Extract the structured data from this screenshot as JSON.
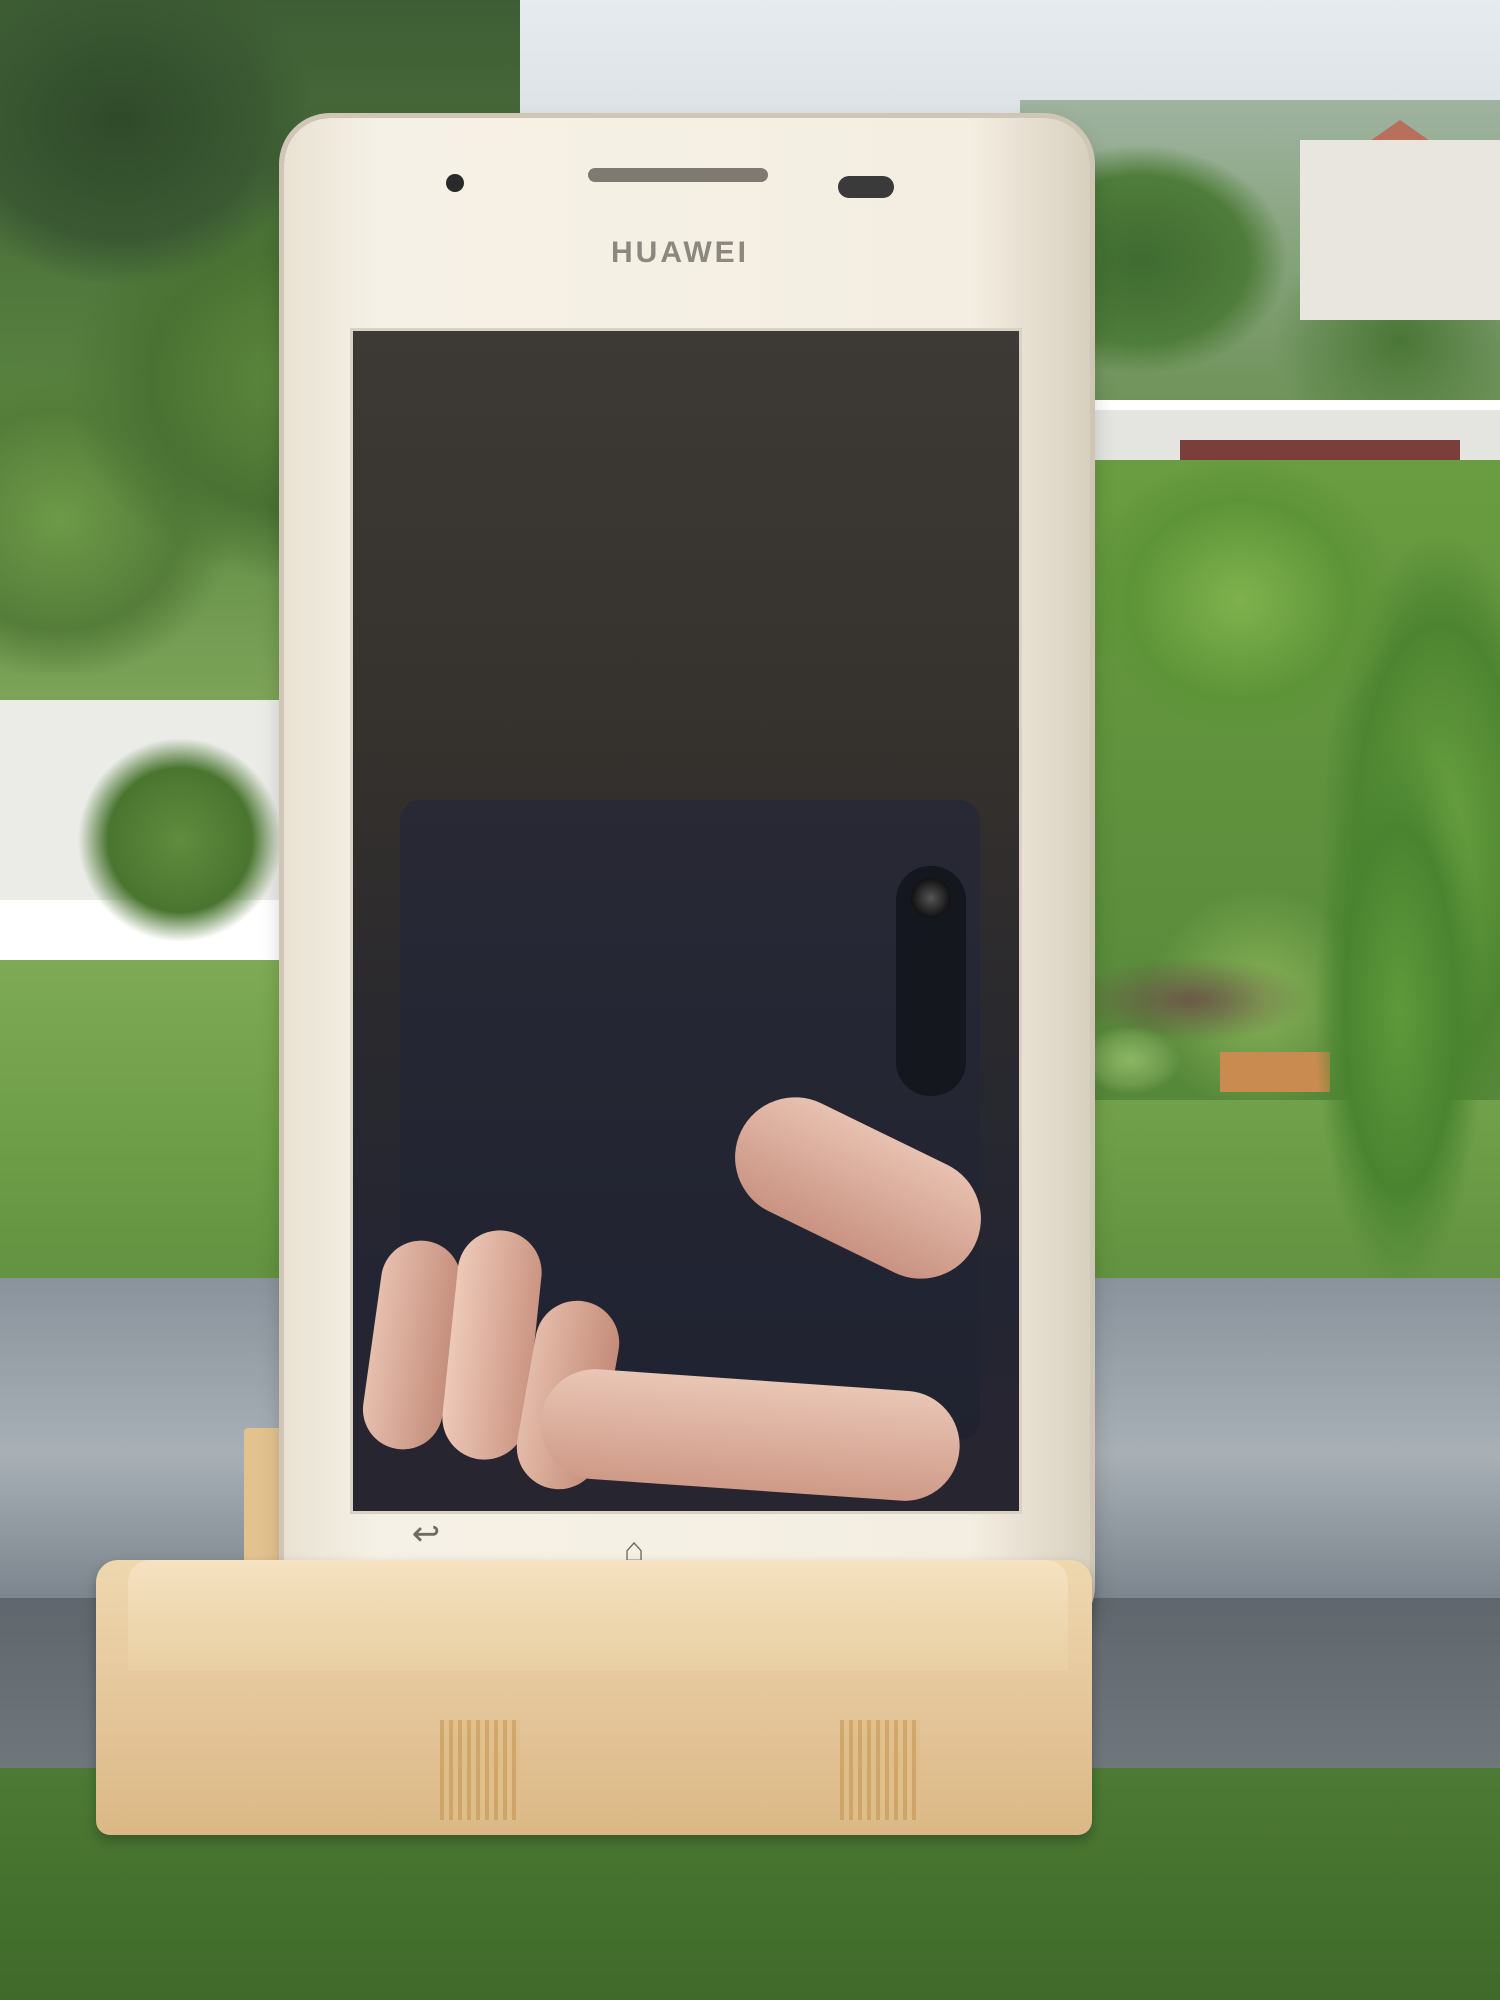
{
  "phone": {
    "brand": "HUAWEI",
    "nav_keys": [
      {
        "name": "back-icon",
        "glyph": "↩"
      },
      {
        "name": "home-icon",
        "glyph": "⌂"
      },
      {
        "name": "menu-icon",
        "glyph": "≡"
      }
    ]
  }
}
